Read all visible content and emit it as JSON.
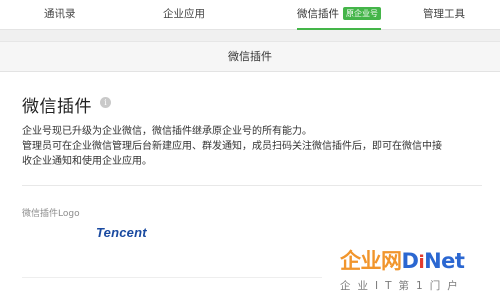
{
  "nav": {
    "tabs": [
      {
        "label": "通讯录"
      },
      {
        "label": "企业应用"
      },
      {
        "label": "微信插件",
        "badge": "原企业号",
        "active": true
      },
      {
        "label": "管理工具"
      }
    ],
    "accent_color": "#44b549"
  },
  "section": {
    "header": "微信插件"
  },
  "plugin": {
    "title": "微信插件",
    "info_icon": "info-icon",
    "desc_line1": "企业号现已升级为企业微信，微信插件继承原企业号的所有能力。",
    "desc_line2": "管理员可在企业微信管理后台新建应用、群发通知，成员扫码关注微信插件后，即可在微信中接",
    "desc_line3": "收企业通知和使用企业应用。",
    "logo_label": "微信插件Logo",
    "logo_text": "Tencent"
  },
  "watermark": {
    "cn": "企业网",
    "d": "D",
    "i": "i",
    "net": "Net",
    "sub": "企业IT第1门户"
  }
}
